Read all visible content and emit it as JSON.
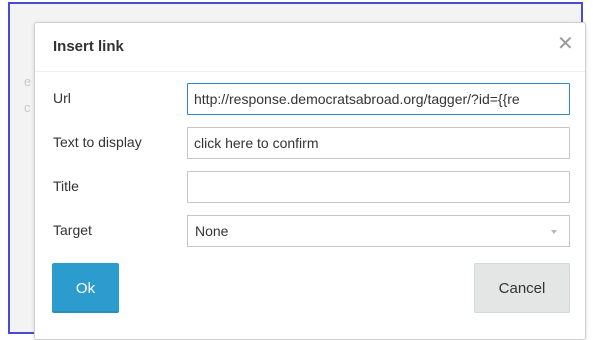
{
  "dialog": {
    "title": "Insert link",
    "close_icon": "close-icon",
    "close_glyph": "✕"
  },
  "form": {
    "url": {
      "label": "Url",
      "value": "http://response.democratsabroad.org/tagger/?id={{re"
    },
    "text_to_display": {
      "label": "Text to display",
      "value": "click here to confirm"
    },
    "title": {
      "label": "Title",
      "value": ""
    },
    "target": {
      "label": "Target",
      "selected": "None"
    }
  },
  "buttons": {
    "ok_label": "Ok",
    "cancel_label": "Cancel"
  },
  "colors": {
    "ok_button": "#2c9ccf",
    "focus_border": "#2d8ac7",
    "outer_border": "#4a4ad6"
  }
}
